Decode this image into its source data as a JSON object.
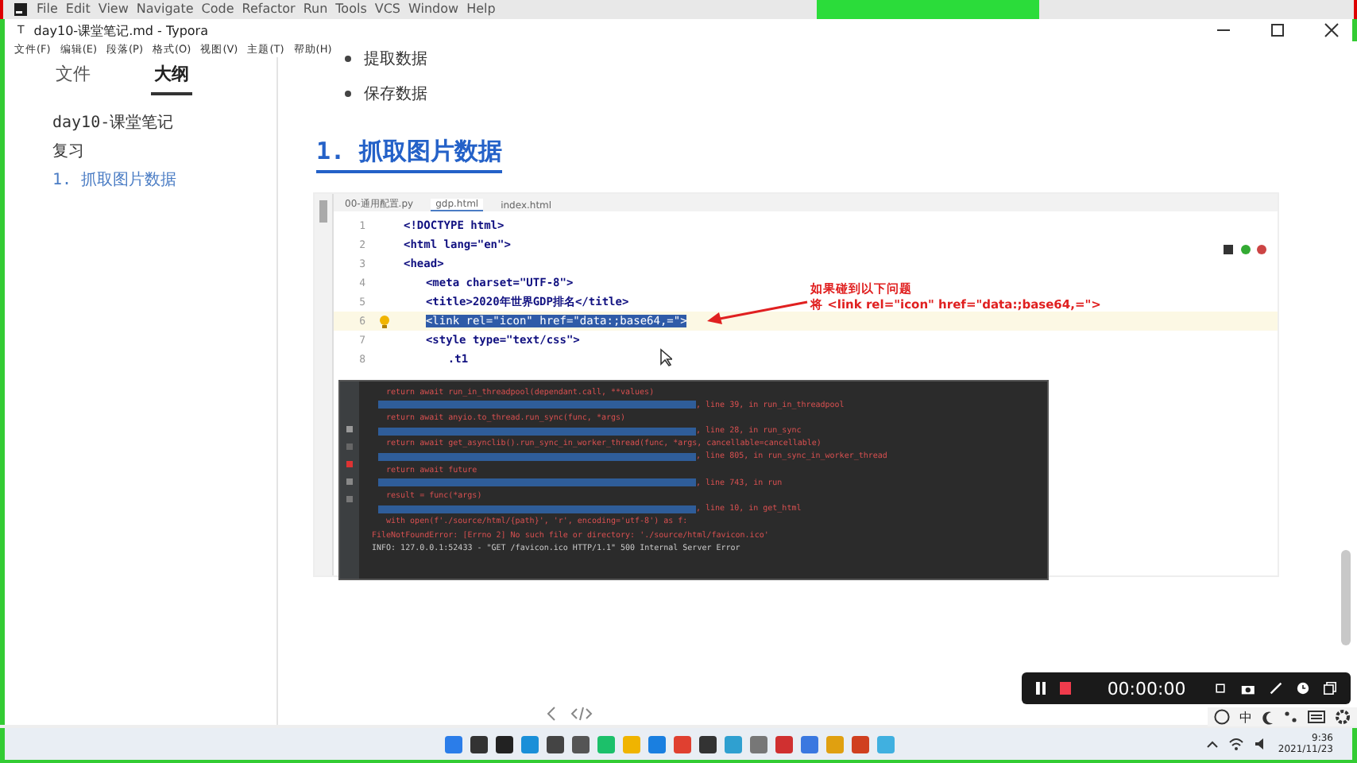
{
  "ide_menu": [
    "File",
    "Edit",
    "View",
    "Navigate",
    "Code",
    "Refactor",
    "Run",
    "Tools",
    "VCS",
    "Window",
    "Help"
  ],
  "window": {
    "logo": "T",
    "title": "day10-课堂笔记.md - Typora"
  },
  "menu": [
    "文件(F)",
    "编辑(E)",
    "段落(P)",
    "格式(O)",
    "视图(V)",
    "主题(T)",
    "帮助(H)"
  ],
  "sidebar": {
    "tabs": [
      {
        "label": "文件",
        "selected": false
      },
      {
        "label": "大纲",
        "selected": true
      }
    ],
    "items": [
      {
        "label": "day10-课堂笔记",
        "selected": false
      },
      {
        "label": "复习",
        "selected": false
      },
      {
        "label": "1. 抓取图片数据",
        "selected": true
      }
    ]
  },
  "bullets": [
    "提取数据",
    "保存数据"
  ],
  "heading": "1. 抓取图片数据",
  "ide": {
    "tabs": [
      {
        "label": "00-通用配置.py",
        "selected": false
      },
      {
        "label": "gdp.html",
        "selected": true
      },
      {
        "label": "index.html",
        "selected": false
      }
    ],
    "lines": [
      {
        "number": "1",
        "text": "<!DOCTYPE html>",
        "highlighted": false
      },
      {
        "number": "2",
        "text": "<html lang=\"en\">",
        "highlighted": false
      },
      {
        "number": "3",
        "text": "<head>",
        "highlighted": false
      },
      {
        "number": "4",
        "text": "    <meta charset=\"UTF-8\">",
        "highlighted": false
      },
      {
        "number": "5",
        "text": "    <title>2020年世界GDP排名</title>",
        "highlighted": false
      },
      {
        "number": "6",
        "text": "    <link rel=\"icon\" href=\"data:;base64,=\">",
        "highlighted": true
      },
      {
        "number": "7",
        "text": "    <style type=\"text/css\">",
        "highlighted": false
      },
      {
        "number": "8",
        "text": "        .t1",
        "highlighted": false
      }
    ],
    "annotation": [
      "如果碰到以下问题",
      "将  <link rel=\"icon\" href=\"data:;base64,=\">"
    ],
    "console": [
      {
        "kind": "code",
        "text": "return await run_in_threadpool(dependant.call, **values)"
      },
      {
        "kind": "file",
        "text": ", line 39, in run_in_threadpool"
      },
      {
        "kind": "code",
        "text": "return await anyio.to_thread.run_sync(func, *args)"
      },
      {
        "kind": "file",
        "text": ", line 28, in run_sync"
      },
      {
        "kind": "code",
        "text": "return await get_asynclib().run_sync_in_worker_thread(func, *args, cancellable=cancellable)"
      },
      {
        "kind": "file",
        "text": ", line 805, in run_sync_in_worker_thread"
      },
      {
        "kind": "code",
        "text": "return await future"
      },
      {
        "kind": "file",
        "text": ", line 743, in run"
      },
      {
        "kind": "code",
        "text": "result = func(*args)"
      },
      {
        "kind": "file",
        "text": ", line 10, in get_html"
      },
      {
        "kind": "code",
        "text": "with open(f'./source/html/{path}', 'r', encoding='utf-8') as f:"
      },
      {
        "kind": "error",
        "text": "FileNotFoundError: [Errno 2] No such file or directory: './source/html/favicon.ico'"
      },
      {
        "kind": "info",
        "text": "INFO:     127.0.0.1:52433 - \"GET /favicon.ico HTTP/1.1\" 500 Internal Server Error"
      }
    ]
  },
  "recorder": {
    "time": "00:00:00"
  },
  "ime": {
    "mode": "中"
  },
  "clock": {
    "time": "9:36",
    "date": "2021/11/23"
  }
}
